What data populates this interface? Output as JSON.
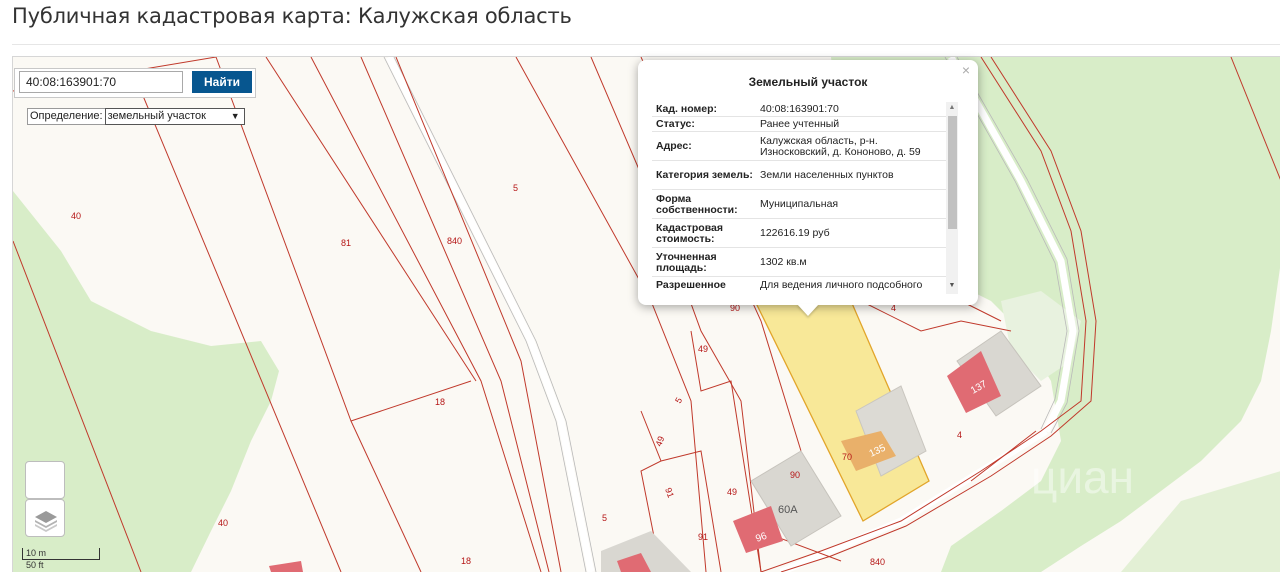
{
  "page": {
    "title": "Публичная кадастровая карта: Калужская область"
  },
  "search": {
    "value": "40:08:163901:70",
    "button_label": "Найти"
  },
  "definition": {
    "label": "Определение:",
    "selected": "земельный участок"
  },
  "scale": {
    "metric": "10 m",
    "imperial": "50 ft"
  },
  "popup": {
    "title": "Земельный участок",
    "close": "×",
    "rows": [
      {
        "key": "Кад. номер:",
        "value": "40:08:163901:70"
      },
      {
        "key": "Статус:",
        "value": "Ранее учтенный"
      },
      {
        "key": "Адрес:",
        "value": "Калужская область, р-н. Износковский, д. Кононово, д. 59"
      },
      {
        "key": "Категория земель:",
        "value": "Земли населенных пунктов"
      },
      {
        "key": "Форма собственности:",
        "value": "Муниципальная"
      },
      {
        "key": "Кадастровая стоимость:",
        "value": "122616.19 руб"
      },
      {
        "key": "Уточненная площадь:",
        "value": "1302 кв.м"
      },
      {
        "key": "Разрешенное",
        "value": "Для ведения личного подсобного"
      }
    ]
  },
  "map_labels": {
    "l40a": "40",
    "l81": "81",
    "l840a": "840",
    "l5a": "5",
    "l18a": "18",
    "l40b": "40",
    "l18b": "18",
    "l5b": "5",
    "l49a": "49",
    "l5c": "5",
    "l49b": "49",
    "l91a": "91",
    "l91b": "91",
    "l49c": "49",
    "l90a": "90",
    "l96": "96",
    "l60a": "60А",
    "l70": "70",
    "l135": "135",
    "l137": "137",
    "l4a": "4",
    "l4b": "4",
    "l840b": "840",
    "l90b": "90"
  },
  "watermark": "циан",
  "colors": {
    "boundary": "#c0392b",
    "selected_fill": "#f7e27a",
    "selected_stroke": "#e2b52a",
    "building_fill": "#e06b73",
    "vegetation": "#d7ecc6",
    "button": "#07568f"
  },
  "icons": {
    "layers": "layers-icon",
    "zoom": "blank-control-icon"
  }
}
